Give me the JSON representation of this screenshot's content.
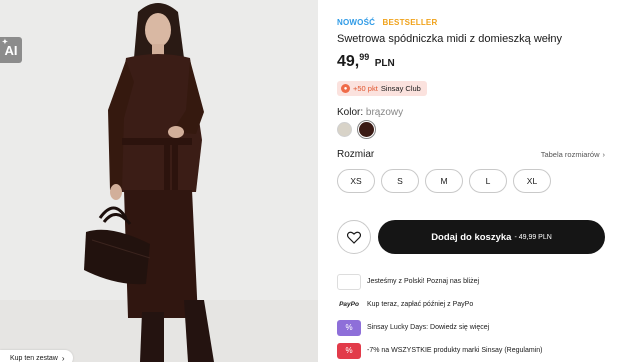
{
  "photo": {
    "ai_badge": "AI",
    "set_pill": "Kup ten zestaw"
  },
  "product": {
    "badge_new": "NOWOŚĆ",
    "badge_bestseller": "BESTSELLER",
    "title": "Swetrowa spódniczka midi z domieszką wełny",
    "price_whole": "49,",
    "price_cents": "99",
    "currency": "PLN",
    "club_points": "+50 pkt",
    "club_name": "Sinsay Club"
  },
  "color": {
    "label": "Kolor:",
    "value": "brązowy",
    "swatches": [
      "#d8d3c8",
      "#3a1a14"
    ]
  },
  "size": {
    "label": "Rozmiar",
    "guide": "Tabela rozmiarów",
    "options": [
      "XS",
      "S",
      "M",
      "L",
      "XL"
    ]
  },
  "cart": {
    "label": "Dodaj do koszyka",
    "price": "- 49,99 PLN"
  },
  "perks": [
    {
      "text": "Jesteśmy z Polski! Poznaj nas bliżej",
      "icon": "poland-flag-icon"
    },
    {
      "text": "Kup teraz, zapłać później z PayPo",
      "icon_label": "PayPo"
    },
    {
      "text": "Sinsay Lucky Days: Dowiedz się więcej",
      "icon": "lucky-days-icon"
    },
    {
      "text": "-7% na WSZYSTKIE produkty marki Sinsay (Regulamin)",
      "icon": "promo-tag-icon"
    }
  ]
}
